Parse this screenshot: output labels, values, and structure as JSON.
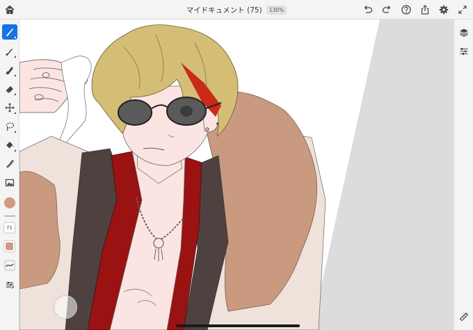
{
  "app": {
    "document_title": "マイドキュメント (75)",
    "zoom_level": "130%"
  },
  "topbar": {
    "left_icons": [
      "home-icon"
    ],
    "right_icons": [
      "undo-icon",
      "redo-icon",
      "help-icon",
      "share-icon",
      "settings-icon",
      "expand-icon"
    ]
  },
  "toolbar": {
    "tools": [
      "pixel-brush-icon",
      "live-brush-icon",
      "vector-brush-icon",
      "eraser-icon",
      "transform-icon",
      "lasso-icon",
      "fill-icon",
      "eyedropper-icon",
      "place-image-icon"
    ],
    "active_tool": "pixel-brush-icon",
    "brush_color": "#cf9b80",
    "brush_size": "71",
    "opacity_swatch_color": "#cf9b80"
  },
  "rightbar": {
    "icons": [
      "layers-icon",
      "layer-properties-icon"
    ],
    "bottom_icon": "ruler-icon"
  },
  "canvas": {
    "background": "#ffffff",
    "gray_region_color": "#dcdcdc",
    "palette": {
      "hair": "#d4bd74",
      "hair_accent": "#c92b18",
      "skin": "#fbe4e1",
      "fur": "#c99a80",
      "shirt": "#9b1212",
      "jacket": "#4f4140",
      "coat_inner": "#eee2da",
      "glasses": "#5a5a5a"
    }
  }
}
